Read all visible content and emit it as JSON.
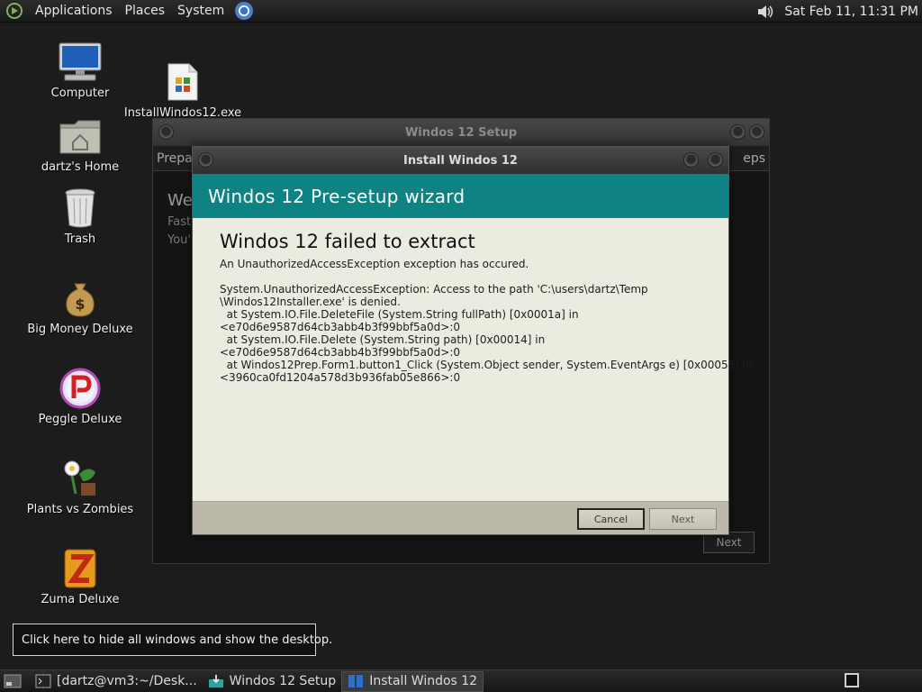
{
  "top_panel": {
    "menus": [
      "Applications",
      "Places",
      "System"
    ],
    "clock": "Sat Feb 11, 11:31 PM",
    "icons": {
      "logo": "distro-logo-icon",
      "browser": "chromium-icon",
      "volume": "volume-icon"
    }
  },
  "desktop_icons": [
    {
      "label": "Computer",
      "icon": "computer-icon"
    },
    {
      "label": "dartz's Home",
      "icon": "home-folder-icon"
    },
    {
      "label": "Trash",
      "icon": "trash-icon"
    },
    {
      "label": "Big Money Deluxe",
      "icon": "money-bag-icon"
    },
    {
      "label": "Peggle Deluxe",
      "icon": "peggle-icon"
    },
    {
      "label": "Plants vs Zombies",
      "icon": "plant-icon"
    },
    {
      "label": "Zuma Deluxe",
      "icon": "zuma-icon"
    },
    {
      "label": "InstallWindos12.exe",
      "icon": "exe-file-icon"
    }
  ],
  "back_window": {
    "title": "Windos 12 Setup",
    "tab_left": "Prepar",
    "tab_right": "eps",
    "line1": "We",
    "line2": "Fast",
    "line3": "You'",
    "next_label": "Next"
  },
  "dialog": {
    "title": "Install Windos 12",
    "banner": "Windos 12 Pre-setup wizard",
    "heading": "Windos 12 failed to extract",
    "subheading": "An UnauthorizedAccessException exception has occured.",
    "trace": "System.UnauthorizedAccessException: Access to the path 'C:\\users\\dartz\\Temp\n\\Windos12Installer.exe' is denied.\n  at System.IO.File.DeleteFile (System.String fullPath) [0x0001a] in\n<e70d6e9587d64cb3abb4b3f99bbf5a0d>:0\n  at System.IO.File.Delete (System.String path) [0x00014] in\n<e70d6e9587d64cb3abb4b3f99bbf5a0d>:0\n  at Windos12Prep.Form1.button1_Click (System.Object sender, System.EventArgs e) [0x00058] in\n<3960ca0fd1204a578d3b936fab05e866>:0",
    "cancel_label": "Cancel",
    "next_label": "Next"
  },
  "tooltip": "Click here to hide all windows and show the desktop.",
  "taskbar": {
    "tasks": [
      {
        "label": "[dartz@vm3:~/Desk...",
        "icon": "terminal-icon",
        "active": false
      },
      {
        "label": "Windos 12 Setup",
        "icon": "installer-icon",
        "active": false
      },
      {
        "label": "Install Windos 12",
        "icon": "window-app-icon",
        "active": true
      }
    ]
  },
  "colors": {
    "banner": "#0d8383",
    "dialog_bg": "#ecebe0",
    "footer": "#bcb8aa"
  }
}
